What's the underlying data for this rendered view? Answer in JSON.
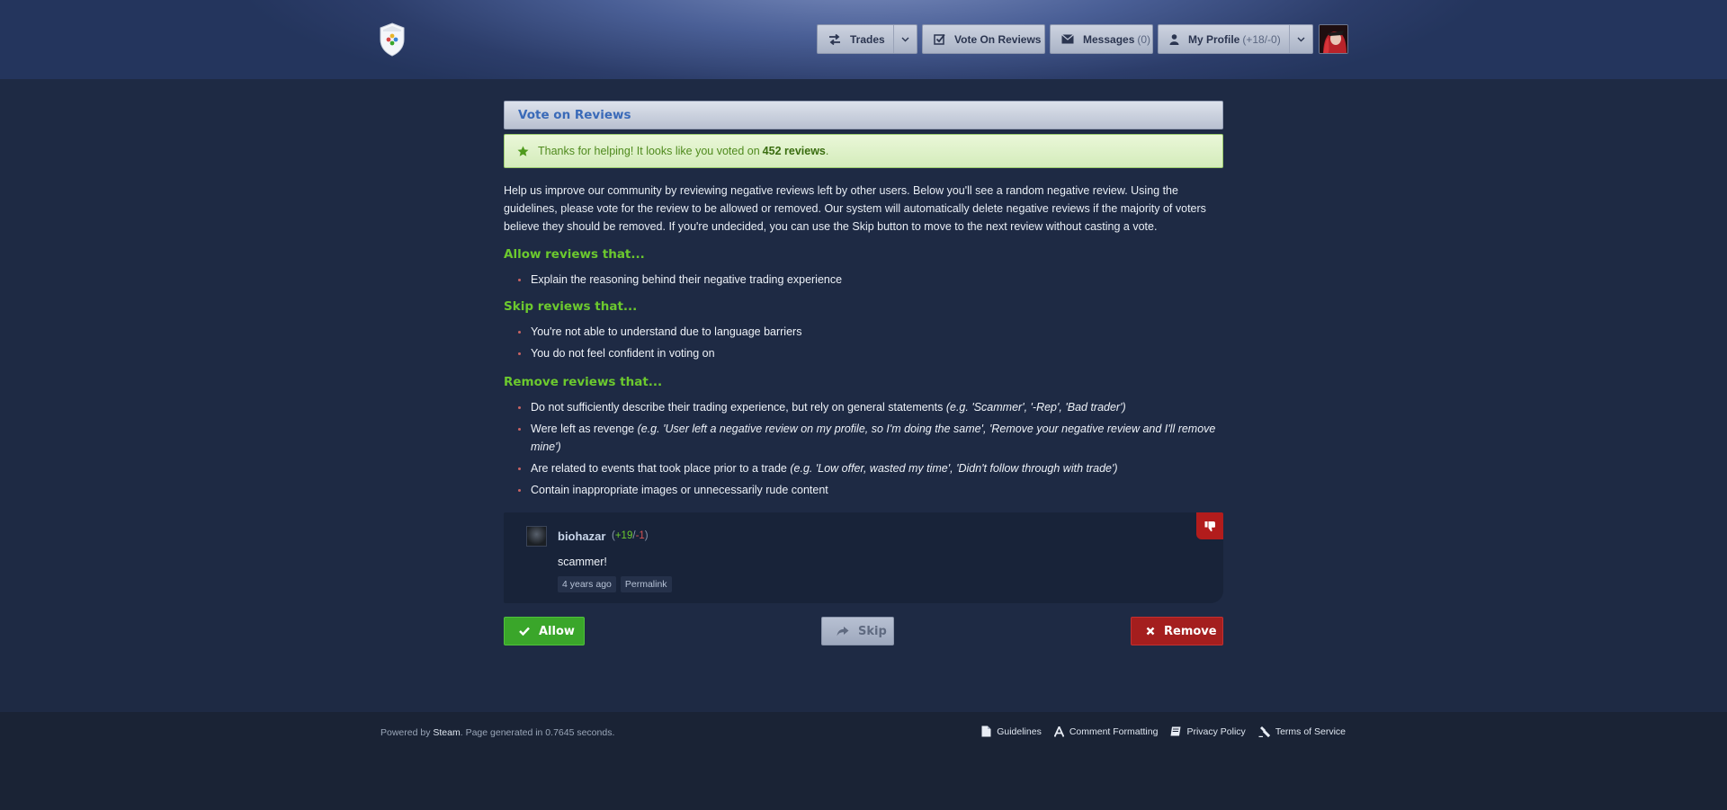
{
  "header": {
    "nav": {
      "trades_label": "Trades",
      "vote_label": "Vote On Reviews",
      "messages_label": "Messages",
      "messages_count": "(0)",
      "profile_label": "My Profile",
      "profile_rep": "(+18/-0)"
    }
  },
  "main": {
    "title": "Vote on Reviews",
    "success": {
      "prefix": "Thanks for helping! It looks like you voted on",
      "count": "452 reviews",
      "suffix": "."
    },
    "intro": "Help us improve our community by reviewing negative reviews left by other users. Below you'll see a random negative review. Using the guidelines, please vote for the review to be allowed or removed. Our system will automatically delete negative reviews if the majority of voters believe they should be removed. If you're undecided, you can use the Skip button to move to the next review without casting a vote.",
    "allow": {
      "heading": "Allow reviews that...",
      "items": [
        "Explain the reasoning behind their negative trading experience"
      ]
    },
    "skip": {
      "heading": "Skip reviews that...",
      "items": [
        "You're not able to understand due to language barriers",
        "You do not feel confident in voting on"
      ]
    },
    "remove": {
      "heading": "Remove reviews that...",
      "items": [
        {
          "text": "Do not sufficiently describe their trading experience, but rely on general statements",
          "example": "(e.g. 'Scammer', '-Rep', 'Bad trader')"
        },
        {
          "text": "Were left as revenge",
          "example": "(e.g. 'User left a negative review on my profile, so I'm doing the same', 'Remove your negative review and I'll remove mine')"
        },
        {
          "text": "Are related to events that took place prior to a trade",
          "example": "(e.g. 'Low offer, wasted my time', 'Didn't follow through with trade')"
        },
        {
          "text": "Contain inappropriate images or unnecessarily rude content",
          "example": ""
        }
      ]
    },
    "review": {
      "username": "biohazar",
      "rep_open": "(",
      "rep_pos": "+19",
      "rep_sep": "/",
      "rep_neg": "-1",
      "rep_close": ")",
      "text": "scammer!",
      "time": "4 years ago",
      "permalink": "Permalink"
    },
    "actions": {
      "allow": "Allow",
      "skip": "Skip",
      "remove": "Remove"
    }
  },
  "footer": {
    "powered_prefix": "Powered by",
    "powered_brand": "Steam",
    "powered_suffix": ". Page generated in 0.7645 seconds.",
    "links": [
      "Guidelines",
      "Comment Formatting",
      "Privacy Policy",
      "Terms of Service"
    ]
  },
  "colors": {
    "accent_green": "#6cc92e",
    "allow_green": "#3aa62a",
    "remove_red": "#a41e1e",
    "title_blue": "#3a6ab8"
  }
}
